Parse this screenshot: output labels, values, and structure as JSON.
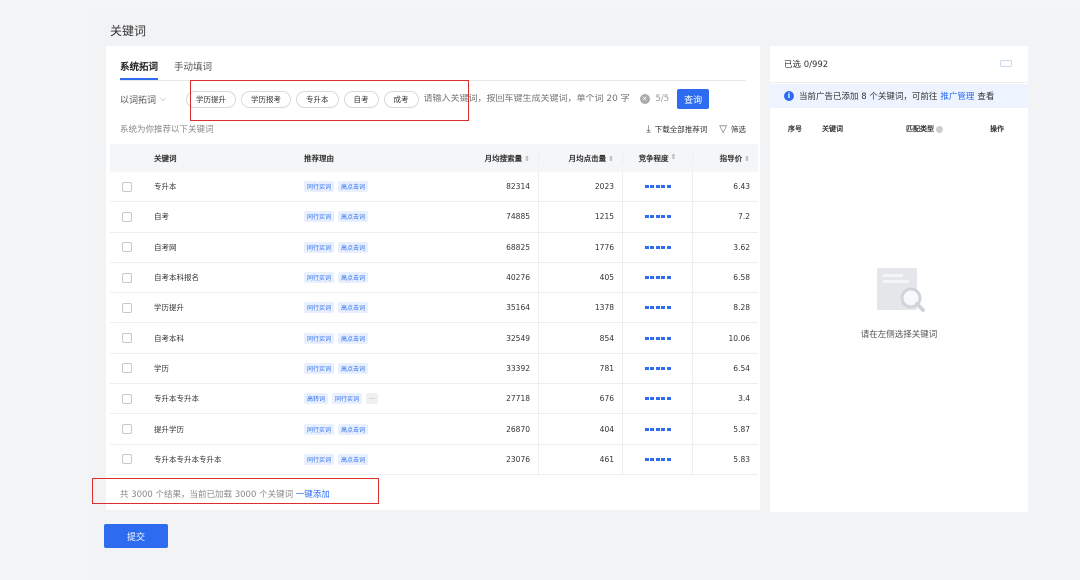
{
  "page": {
    "title": "关键词"
  },
  "tabs": [
    {
      "label": "系统拓词",
      "active": true
    },
    {
      "label": "手动填词",
      "active": false
    }
  ],
  "search": {
    "mode_label": "以词拓词",
    "chips": [
      "学历提升",
      "学历报考",
      "专升本",
      "自考",
      "成考"
    ],
    "placeholder": "请输入关键词，按回车键生成关键词，单个词 20 字",
    "counter": "5/5",
    "query_button": "查询"
  },
  "recommend": {
    "text": "系统为你推荐以下关键词",
    "download_label": "下载全部推荐词",
    "filter_label": "筛选"
  },
  "table": {
    "headers": {
      "keyword": "关键词",
      "reason": "推荐理由",
      "monthly_search": "月均搜索量",
      "monthly_click": "月均点击量",
      "competition": "竞争程度",
      "price": "指导价"
    },
    "rows": [
      {
        "keyword": "专升本",
        "tags": [
          "同行买词",
          "高点击词"
        ],
        "search": "82314",
        "click": "2023",
        "price": "6.43"
      },
      {
        "keyword": "自考",
        "tags": [
          "同行买词",
          "高点击词"
        ],
        "search": "74885",
        "click": "1215",
        "price": "7.2"
      },
      {
        "keyword": "自考网",
        "tags": [
          "同行买词",
          "高点击词"
        ],
        "search": "68825",
        "click": "1776",
        "price": "3.62"
      },
      {
        "keyword": "自考本科报名",
        "tags": [
          "同行买词",
          "高点击词"
        ],
        "search": "40276",
        "click": "405",
        "price": "6.58"
      },
      {
        "keyword": "学历提升",
        "tags": [
          "同行买词",
          "高点击词"
        ],
        "search": "35164",
        "click": "1378",
        "price": "8.28"
      },
      {
        "keyword": "自考本科",
        "tags": [
          "同行买词",
          "高点击词"
        ],
        "search": "32549",
        "click": "854",
        "price": "10.06"
      },
      {
        "keyword": "学历",
        "tags": [
          "同行买词",
          "高点击词"
        ],
        "search": "33392",
        "click": "781",
        "price": "6.54"
      },
      {
        "keyword": "专升本专升本",
        "tags": [
          "高转词",
          "同行买词",
          "..."
        ],
        "search": "27718",
        "click": "676",
        "price": "3.4"
      },
      {
        "keyword": "提升学历",
        "tags": [
          "同行买词",
          "高点击词"
        ],
        "search": "26870",
        "click": "404",
        "price": "5.87"
      },
      {
        "keyword": "专升本专升本专升本",
        "tags": [
          "同行买词",
          "高点击词"
        ],
        "search": "23076",
        "click": "461",
        "price": "5.83"
      }
    ]
  },
  "footer": {
    "summary": "共 3000 个结果，当前已加载 3000 个关键词",
    "add_all": "一键添加"
  },
  "submit_label": "提交",
  "right": {
    "selected": "已选 0/992",
    "info_prefix": "当前广告已添加 8 个关键词，可前往",
    "info_link": "推广管理",
    "info_suffix": "查看",
    "headers": {
      "index": "序号",
      "keyword": "关键词",
      "match": "匹配类型",
      "action": "操作"
    },
    "empty_text": "请在左侧选择关键词"
  },
  "colors": {
    "accent": "#2d6cf0",
    "highlight_box": "#d9302c"
  }
}
